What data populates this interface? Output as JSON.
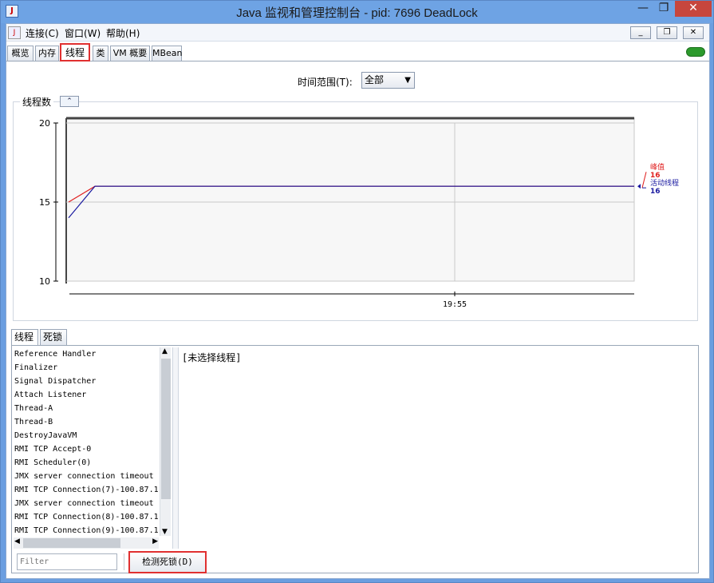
{
  "window": {
    "title": "Java 监视和管理控制台 - pid: 7696 DeadLock",
    "min_glyph": "—",
    "max_glyph": "❐",
    "close_glyph": "✕"
  },
  "menu": {
    "items": [
      "连接(C)",
      "窗口(W)",
      "帮助(H)"
    ],
    "mdi_min": "_",
    "mdi_restore": "❐",
    "mdi_close": "✕"
  },
  "tabs": [
    "概览",
    "内存",
    "线程",
    "类",
    "VM 概要",
    "MBean"
  ],
  "active_tab": "线程",
  "timerange": {
    "label": "时间范围(T):",
    "value": "全部"
  },
  "chart_panel": {
    "title": "线程数",
    "collapse_glyph": "⌃"
  },
  "chart_data": {
    "type": "line",
    "title": "线程数",
    "ylim": [
      10,
      20
    ],
    "yticks": [
      "20",
      "15",
      "10"
    ],
    "xticks": [
      "19:55"
    ],
    "series": [
      {
        "name": "峰值",
        "color": "#e02020",
        "values": [
          15,
          16,
          16
        ]
      },
      {
        "name": "活动线程",
        "color": "#1a1aa0",
        "values": [
          14,
          16,
          16
        ]
      }
    ],
    "legend": [
      {
        "name": "峰值",
        "value": "16",
        "color": "#e02020"
      },
      {
        "name": "活动线程",
        "value": "16",
        "color": "#1a1aa0"
      }
    ]
  },
  "subtabs": [
    "线程",
    "死锁"
  ],
  "threads": [
    "Reference Handler",
    "Finalizer",
    "Signal Dispatcher",
    "Attach Listener",
    "Thread-A",
    "Thread-B",
    "DestroyJavaVM",
    "RMI TCP Accept-0",
    "RMI Scheduler(0)",
    "JMX server connection timeout",
    "RMI TCP Connection(7)-100.87.1",
    "JMX server connection timeout",
    "RMI TCP Connection(8)-100.87.1",
    "RMI TCP Connection(9)-100.87.1"
  ],
  "detail_text": "[未选择线程]",
  "filter_placeholder": "Filter",
  "detect_button": "检测死锁(D)"
}
